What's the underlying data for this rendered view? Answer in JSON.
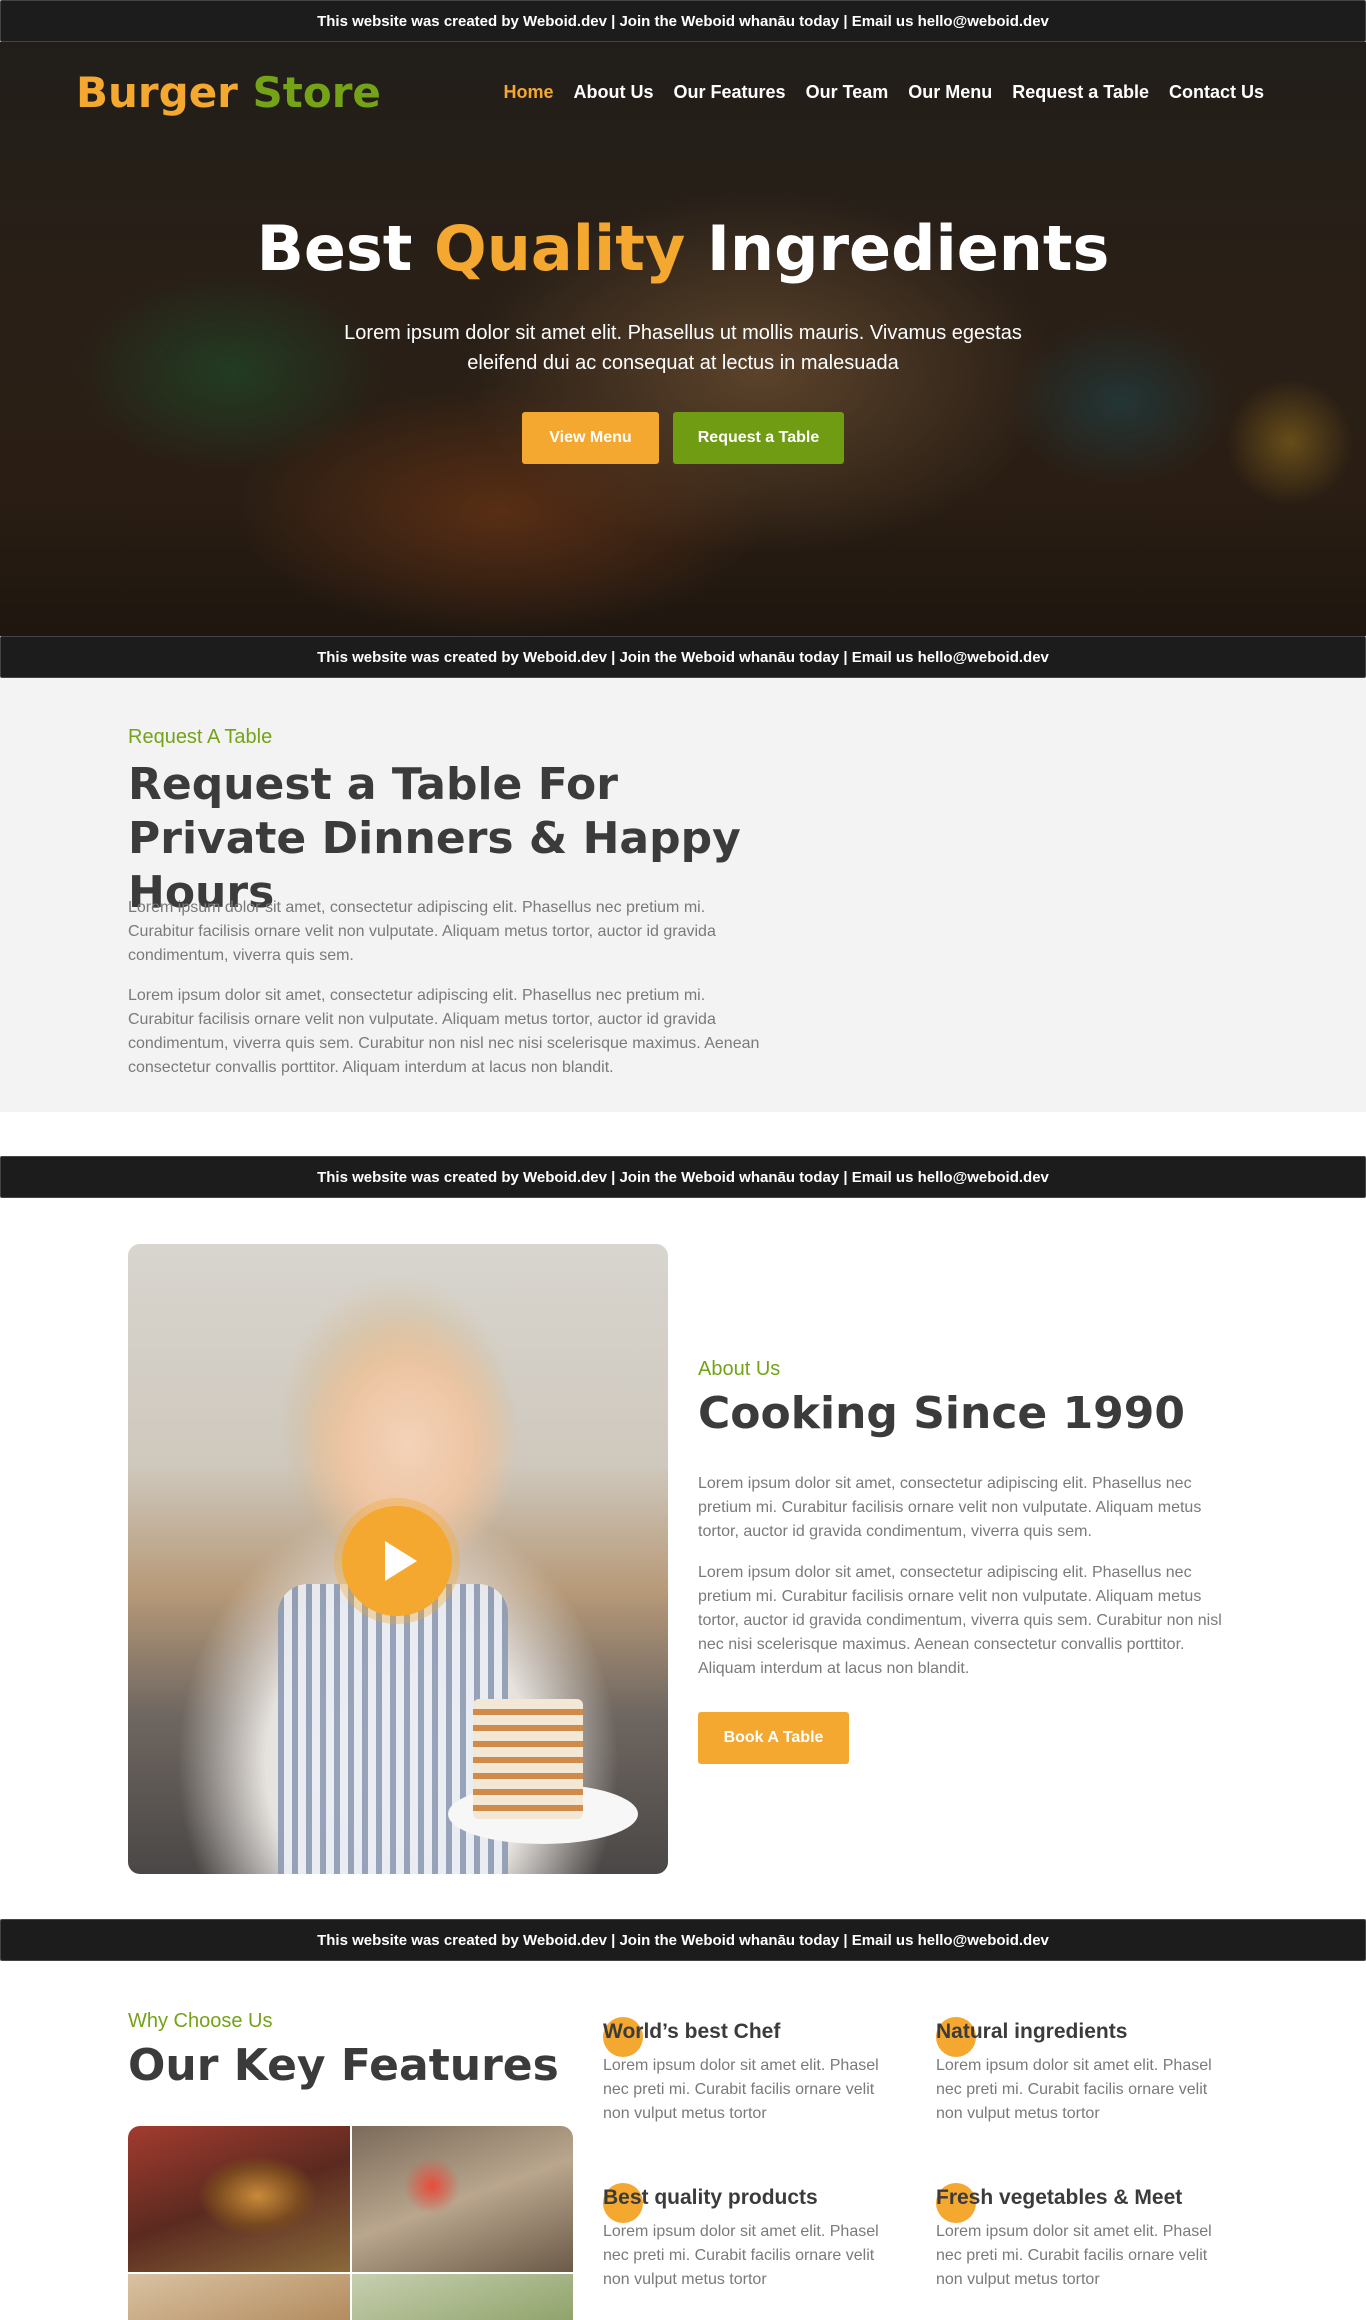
{
  "banner": {
    "text": "This website was created by Weboid.dev | Join the Weboid whanāu today | Email us hello@weboid.dev"
  },
  "header": {
    "logo_part1": "Burger",
    "logo_part2": "Store",
    "nav": [
      "Home",
      "About Us",
      "Our Features",
      "Our Team",
      "Our Menu",
      "Request a Table",
      "Contact Us"
    ]
  },
  "hero": {
    "title_part1": "Best",
    "title_highlight": "Quality",
    "title_part2": "Ingredients",
    "subtitle": "Lorem ipsum dolor sit amet elit. Phasellus ut mollis mauris. Vivamus egestas eleifend dui ac consequat at lectus in malesuada",
    "btn_menu": "View Menu",
    "btn_table": "Request a Table"
  },
  "request": {
    "eyebrow": "Request A Table",
    "title": "Request a Table For Private Dinners & Happy Hours",
    "para1": "Lorem ipsum dolor sit amet, consectetur adipiscing elit. Phasellus nec pretium mi. Curabitur facilisis ornare velit non vulputate. Aliquam metus tortor, auctor id gravida condimentum, viverra quis sem.",
    "para2": "Lorem ipsum dolor sit amet, consectetur adipiscing elit. Phasellus nec pretium mi. Curabitur facilisis ornare velit non vulputate. Aliquam metus tortor, auctor id gravida condimentum, viverra quis sem. Curabitur non nisl nec nisi scelerisque maximus. Aenean consectetur convallis porttitor. Aliquam interdum at lacus non blandit."
  },
  "about": {
    "eyebrow": "About Us",
    "title": "Cooking Since 1990",
    "para1": "Lorem ipsum dolor sit amet, consectetur adipiscing elit. Phasellus nec pretium mi. Curabitur facilisis ornare velit non vulputate. Aliquam metus tortor, auctor id gravida condimentum, viverra quis sem.",
    "para2": "Lorem ipsum dolor sit amet, consectetur adipiscing elit. Phasellus nec pretium mi. Curabitur facilisis ornare velit non vulputate. Aliquam metus tortor, auctor id gravida condimentum, viverra quis sem. Curabitur non nisl nec nisi scelerisque maximus. Aenean consectetur convallis porttitor. Aliquam interdum at lacus non blandit.",
    "btn": "Book A Table"
  },
  "features": {
    "eyebrow": "Why Choose Us",
    "title": "Our Key Features",
    "items": [
      {
        "title": "World’s best Chef",
        "text": "Lorem ipsum dolor sit amet elit. Phasel nec preti mi. Curabit facilis ornare velit non vulput metus tortor"
      },
      {
        "title": "Natural ingredients",
        "text": "Lorem ipsum dolor sit amet elit. Phasel nec preti mi. Curabit facilis ornare velit non vulput metus tortor"
      },
      {
        "title": "Best quality products",
        "text": "Lorem ipsum dolor sit amet elit. Phasel nec preti mi. Curabit facilis ornare velit non vulput metus tortor"
      },
      {
        "title": "Fresh vegetables & Meet",
        "text": "Lorem ipsum dolor sit amet elit. Phasel nec preti mi. Curabit facilis ornare velit non vulput metus tortor"
      }
    ]
  },
  "colors": {
    "accent_orange": "#f4a830",
    "accent_green": "#74a317",
    "banner_bg": "#1c1c1c"
  }
}
